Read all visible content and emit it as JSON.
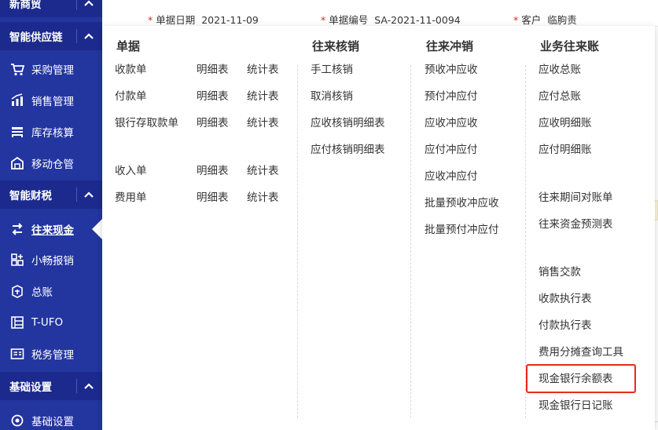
{
  "sidebar": {
    "top_cut_label": "新商贸",
    "groups": [
      {
        "label": "智能供应链"
      },
      {
        "label": "智能财税"
      },
      {
        "label": "基础设置"
      }
    ],
    "items": [
      {
        "label": "采购管理",
        "icon": "cart-icon"
      },
      {
        "label": "销售管理",
        "icon": "sales-chart-icon"
      },
      {
        "label": "库存核算",
        "icon": "inventory-icon"
      },
      {
        "label": "移动仓管",
        "icon": "mobile-warehouse-icon"
      },
      {
        "label": "往来现金",
        "icon": "exchange-icon"
      },
      {
        "label": "小畅报销",
        "icon": "reimburse-icon"
      },
      {
        "label": "总账",
        "icon": "ledger-icon"
      },
      {
        "label": "T-UFO",
        "icon": "report-icon"
      },
      {
        "label": "税务管理",
        "icon": "tax-icon"
      },
      {
        "label": "基础设置",
        "icon": "settings-icon"
      }
    ],
    "active_item": "往来现金",
    "colors": {
      "bg": "#23359f",
      "group_bg": "#1b2a8c"
    }
  },
  "background_form": {
    "fields": [
      {
        "label": "单据日期",
        "value": "2021-11-09"
      },
      {
        "label": "单据编号",
        "value": "SA-2021-11-0094"
      },
      {
        "label": "客户",
        "value": "临朐责"
      }
    ]
  },
  "menu": {
    "columns": [
      {
        "title": "单据",
        "rows": [
          {
            "name": "收款单",
            "detail": "明细表",
            "stats": "统计表"
          },
          {
            "name": "付款单",
            "detail": "明细表",
            "stats": "统计表"
          },
          {
            "name": "银行存取款单",
            "detail": "明细表",
            "stats": "统计表"
          },
          {
            "name": "收入单",
            "detail": "明细表",
            "stats": "统计表"
          },
          {
            "name": "费用单",
            "detail": "明细表",
            "stats": "统计表"
          }
        ]
      },
      {
        "title": "往来核销",
        "items": [
          "手工核销",
          "取消核销",
          "应收核销明细表",
          "应付核销明细表"
        ]
      },
      {
        "title": "往来冲销",
        "items": [
          "预收冲应收",
          "预付冲应付",
          "应收冲应收",
          "应付冲应付",
          "应收冲应付",
          "批量预收冲应收",
          "批量预付冲应付"
        ]
      },
      {
        "title": "业务往来账",
        "items": [
          "应收总账",
          "应付总账",
          "应收明细账",
          "应付明细账",
          "往来期间对账单",
          "往来资金预测表",
          "销售交款",
          "收款执行表",
          "付款执行表",
          "费用分摊查询工具",
          "现金银行余额表",
          "现金银行日记账"
        ]
      }
    ],
    "highlighted_item": "现金银行余额表",
    "highlight_color": "#e8291c"
  }
}
